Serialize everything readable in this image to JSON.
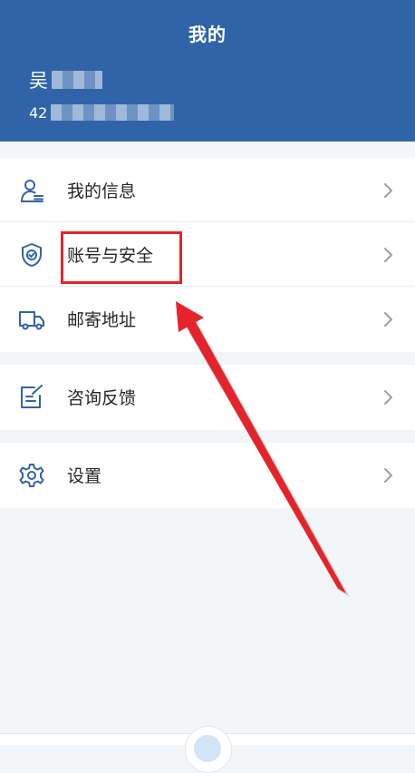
{
  "header": {
    "title": "我的",
    "user_name": "吴",
    "user_id": "42"
  },
  "menu": {
    "items": [
      {
        "label": "我的信息",
        "icon": "user-profile-icon"
      },
      {
        "label": "账号与安全",
        "icon": "shield-check-icon"
      },
      {
        "label": "邮寄地址",
        "icon": "truck-icon"
      },
      {
        "label": "咨询反馈",
        "icon": "feedback-edit-icon"
      },
      {
        "label": "设置",
        "icon": "gear-icon"
      }
    ]
  },
  "colors": {
    "header_bg": "#2f64a8",
    "icon_blue": "#2f64a8",
    "annotation_red": "#e5232a",
    "page_bg": "#f3f6f9"
  }
}
